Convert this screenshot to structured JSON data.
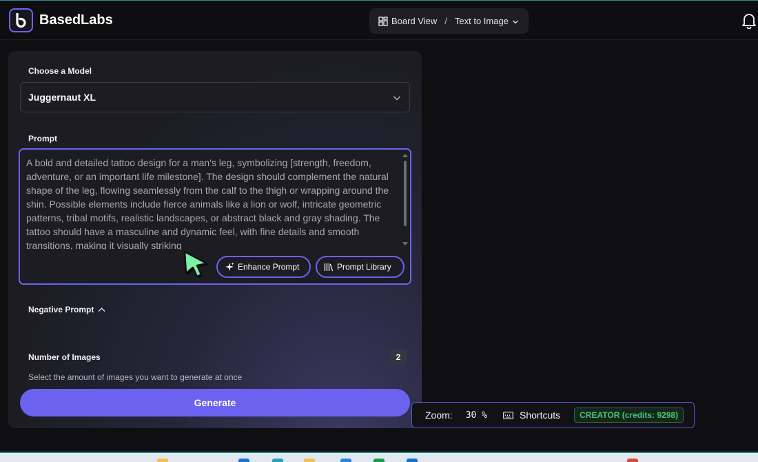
{
  "header": {
    "brand": "BasedLabs",
    "breadcrumb": {
      "board": "Board View",
      "separator": "/",
      "page": "Text to Image"
    }
  },
  "panel": {
    "model_label": "Choose a Model",
    "model_value": "Juggernaut XL",
    "prompt_label": "Prompt",
    "prompt_text": "A bold and detailed tattoo design for a man's leg, symbolizing [strength, freedom, adventure, or an important life milestone]. The design should complement the natural shape of the leg, flowing seamlessly from the calf to the thigh or wrapping around the shin. Possible elements include fierce animals like a lion or wolf, intricate geometric patterns, tribal motifs, realistic landscapes, or abstract black and gray shading. The tattoo should have a masculine and dynamic feel, with fine details and smooth transitions, making it visually striking",
    "enhance_label": "Enhance Prompt",
    "library_label": "Prompt Library",
    "negative_label": "Negative Prompt",
    "num_images_label": "Number of Images",
    "num_images_value": "2",
    "num_images_hint": "Select the amount of images you want to generate at once",
    "generate_label": "Generate"
  },
  "zoombar": {
    "zoom_label": "Zoom:",
    "zoom_value": "30 %",
    "shortcuts_label": "Shortcuts",
    "plan_badge": "CREATOR (credits: 9298)"
  },
  "colors": {
    "accent": "#6b63f0",
    "badge_green": "#41c777",
    "panel_bg": "#1c1c22"
  },
  "icons": [
    "logo-icon",
    "board-grid-icon",
    "chevron-down-icon",
    "bell-icon",
    "sparkle-icon",
    "library-icon",
    "chevron-up-icon",
    "keyboard-icon",
    "cursor-icon"
  ]
}
